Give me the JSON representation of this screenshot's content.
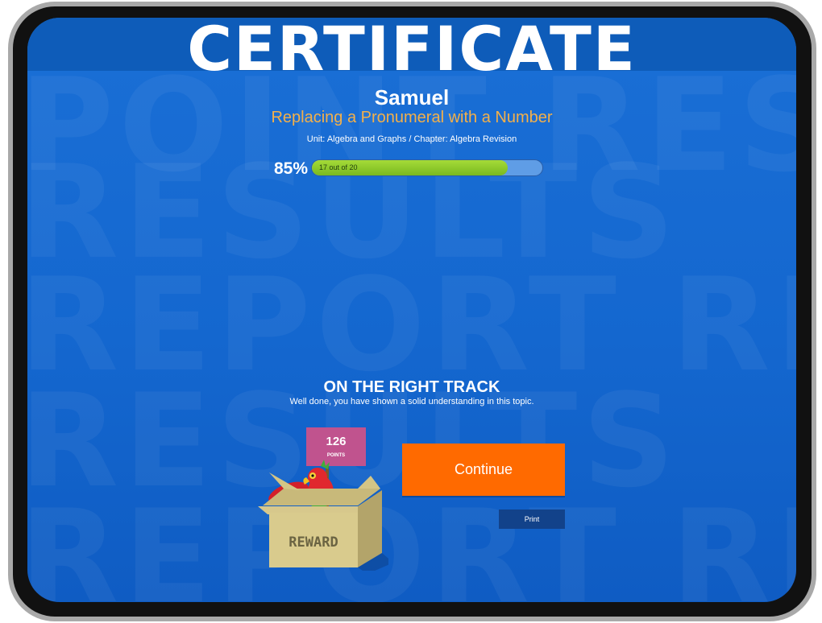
{
  "banner": {
    "title": "CERTIFICATE"
  },
  "watermark": {
    "words": [
      "POINT RESULTS",
      "RESULTS",
      "REPORT RESULTS",
      "RESULTS",
      "REPORT RESULTS"
    ]
  },
  "student": {
    "name": "Samuel"
  },
  "lesson": {
    "title": "Replacing a Pronumeral with a Number",
    "path": "Unit: Algebra and Graphs / Chapter: Algebra Revision"
  },
  "score": {
    "percent_label": "85%",
    "progress": 0.85,
    "detail": "17 out of 20"
  },
  "feedback": {
    "heading": "ON THE RIGHT TRACK",
    "message": "Well done, you have shown a solid understanding in this topic."
  },
  "reward": {
    "points": "126",
    "points_label": "POINTS",
    "box_label": "REWARD"
  },
  "actions": {
    "continue_label": "Continue",
    "print_label": "Print"
  },
  "colors": {
    "accent_orange": "#ff6a00",
    "lesson_gold": "#f3b04a",
    "progress_green": "#8fcc2c",
    "screen_blue": "#1467cf"
  }
}
